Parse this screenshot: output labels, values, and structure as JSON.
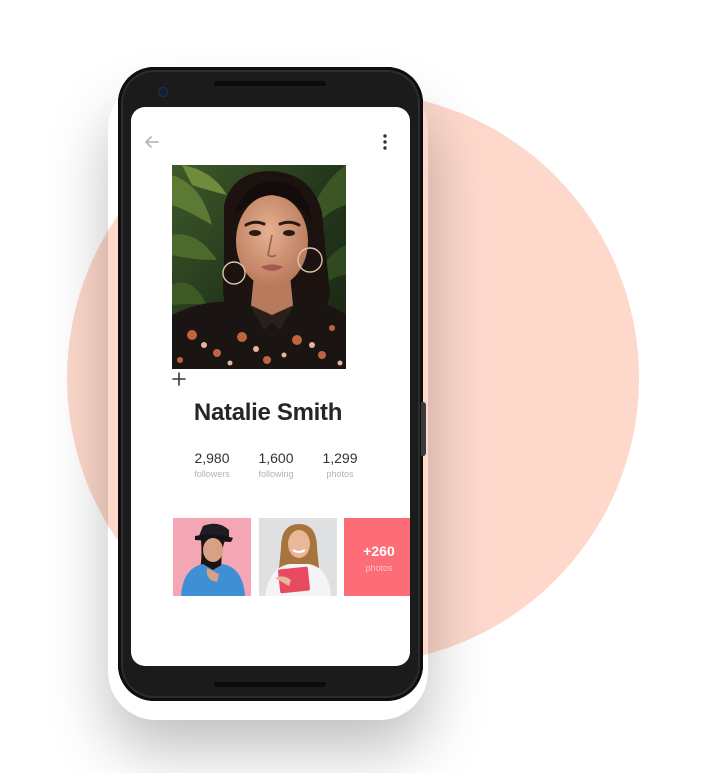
{
  "colors": {
    "background_circle": "#fdd8cb",
    "phone_body": "#1b1b1c",
    "screen_background": "#ffffff",
    "name_text": "#262626",
    "stat_value": "#333333",
    "stat_label": "#b3b3b3",
    "accent": "#fd6d77"
  },
  "header": {
    "back_icon": "arrow-left-icon",
    "menu_icon": "more-vertical-icon"
  },
  "profile": {
    "avatar_icon": "profile-photo",
    "add_icon": "plus-icon",
    "name": "Natalie Smith"
  },
  "stats": [
    {
      "value": "2,980",
      "label": "followers"
    },
    {
      "value": "1,600",
      "label": "following"
    },
    {
      "value": "1,299",
      "label": "photos"
    }
  ],
  "gallery": {
    "more_count": "+260",
    "more_label": "photos"
  }
}
